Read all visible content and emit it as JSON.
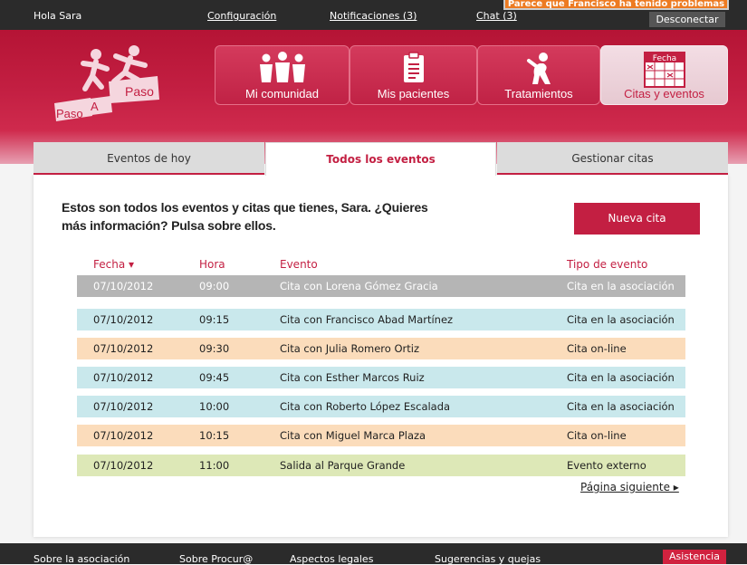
{
  "topbar": {
    "greeting": "Hola Sara",
    "config": "Configuración",
    "notifications": "Notificaciones (3)",
    "chat": "Chat (3)",
    "logout": "Desconectar",
    "toast": "Parece que Francisco ha tenido problemas"
  },
  "logo": {
    "word1": "Paso",
    "word2": "A",
    "word3": "Paso"
  },
  "nav": [
    {
      "label": "Mi comunidad",
      "icon": "people-icon"
    },
    {
      "label": "Mis pacientes",
      "icon": "clipboard-icon"
    },
    {
      "label": "Tratamientos",
      "icon": "exercise-icon"
    },
    {
      "label": "Citas y eventos",
      "icon": "calendar-icon",
      "icon_text": "Fecha",
      "active": true
    }
  ],
  "tabs": [
    {
      "label": "Eventos de hoy"
    },
    {
      "label": "Todos los eventos",
      "active": true
    },
    {
      "label": "Gestionar citas"
    }
  ],
  "intro": "Estos son todos los eventos y citas que tienes, Sara. ¿Quieres más información? Pulsa sobre ellos.",
  "new_button": "Nueva cita",
  "table": {
    "headers": {
      "date": "Fecha ▾",
      "time": "Hora",
      "event": "Evento",
      "type": "Tipo de evento"
    },
    "rows": [
      {
        "date": "07/10/2012",
        "time": "09:00",
        "event": "Cita con Lorena Gómez Gracia",
        "type": "Cita en la asociación",
        "kind": "past"
      },
      {
        "date": "07/10/2012",
        "time": "09:15",
        "event": "Cita con Francisco Abad Martínez",
        "type": "Cita en la asociación",
        "kind": "assoc"
      },
      {
        "date": "07/10/2012",
        "time": "09:30",
        "event": "Cita con Julia Romero Ortiz",
        "type": "Cita on-line",
        "kind": "online"
      },
      {
        "date": "07/10/2012",
        "time": "09:45",
        "event": "Cita con Esther Marcos Ruiz",
        "type": "Cita en la asociación",
        "kind": "assoc"
      },
      {
        "date": "07/10/2012",
        "time": "10:00",
        "event": "Cita con Roberto López Escalada",
        "type": "Cita en la asociación",
        "kind": "assoc"
      },
      {
        "date": "07/10/2012",
        "time": "10:15",
        "event": "Cita con Miguel Marca Plaza",
        "type": "Cita on-line",
        "kind": "online"
      },
      {
        "date": "07/10/2012",
        "time": "11:00",
        "event": "Salida al Parque Grande",
        "type": "Evento externo",
        "kind": "external"
      }
    ]
  },
  "row_colors": {
    "past": "#b5b5b5",
    "assoc": "#c9e8ec",
    "online": "#fbdcbb",
    "external": "#dde8b7"
  },
  "next_page": "Página siguiente ▸",
  "footer": {
    "about": "Sobre la asociación",
    "procura": "Sobre Procur@",
    "legal": "Aspectos legales",
    "suggestions": "Sugerencias y quejas",
    "assist": "Asistencia"
  },
  "colors": {
    "brand": "#c31f42",
    "dark_bar": "#2b2b2b"
  }
}
